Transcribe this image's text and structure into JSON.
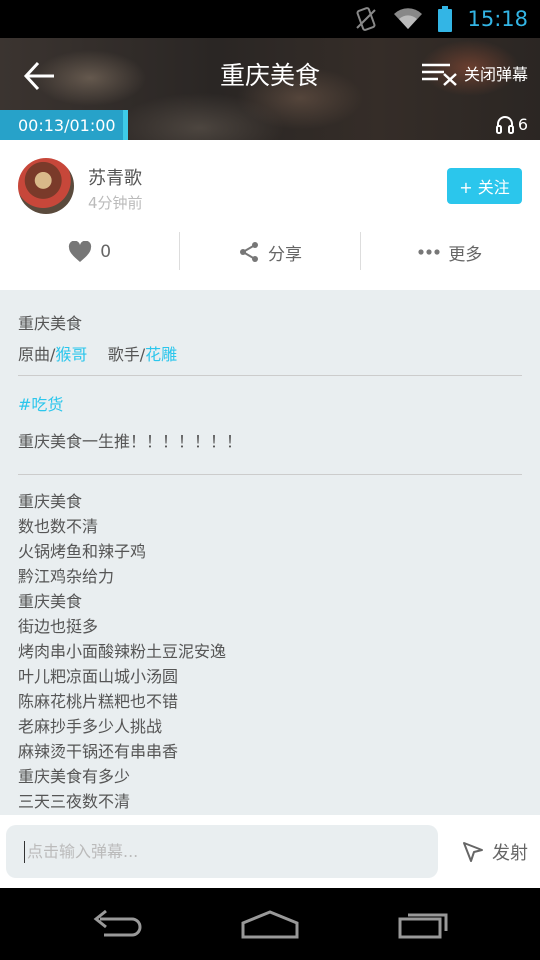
{
  "status_bar": {
    "time": "15:18",
    "icons": [
      "vibrate-icon",
      "wifi-icon",
      "battery-icon"
    ]
  },
  "header": {
    "title": "重庆美食",
    "danmu_toggle_label": "关闭弹幕",
    "playback_time": "00:13/01:00",
    "listener_count": "6"
  },
  "author": {
    "name": "苏青歌",
    "posted": "4分钟前",
    "follow_label": "+ 关注"
  },
  "actions": {
    "like_count": "0",
    "share_label": "分享",
    "more_label": "更多"
  },
  "song": {
    "title": "重庆美食",
    "original_prefix": "原曲/",
    "original_name": "猴哥",
    "singer_prefix": "歌手/",
    "singer_name": "花雕",
    "tag": "#吃货",
    "description": "重庆美食一生推！！！！！！！",
    "lyrics": [
      "重庆美食",
      "数也数不清",
      "火锅烤鱼和辣子鸡",
      "黔江鸡杂给力",
      "重庆美食",
      "街边也挺多",
      "烤肉串小面酸辣粉土豆泥安逸",
      "叶儿粑凉面山城小汤圆",
      "陈麻花桃片糕粑也不错",
      "老麻抄手多少人挑战",
      "麻辣烫干锅还有串串香",
      "重庆美食有多少",
      "三天三夜数不清"
    ]
  },
  "comment_bar": {
    "placeholder": "点击输入弹幕...",
    "send_label": "发射"
  },
  "colors": {
    "accent": "#2bc6ec",
    "status_blue": "#33b5e5",
    "timebox": "#27a2c9"
  }
}
